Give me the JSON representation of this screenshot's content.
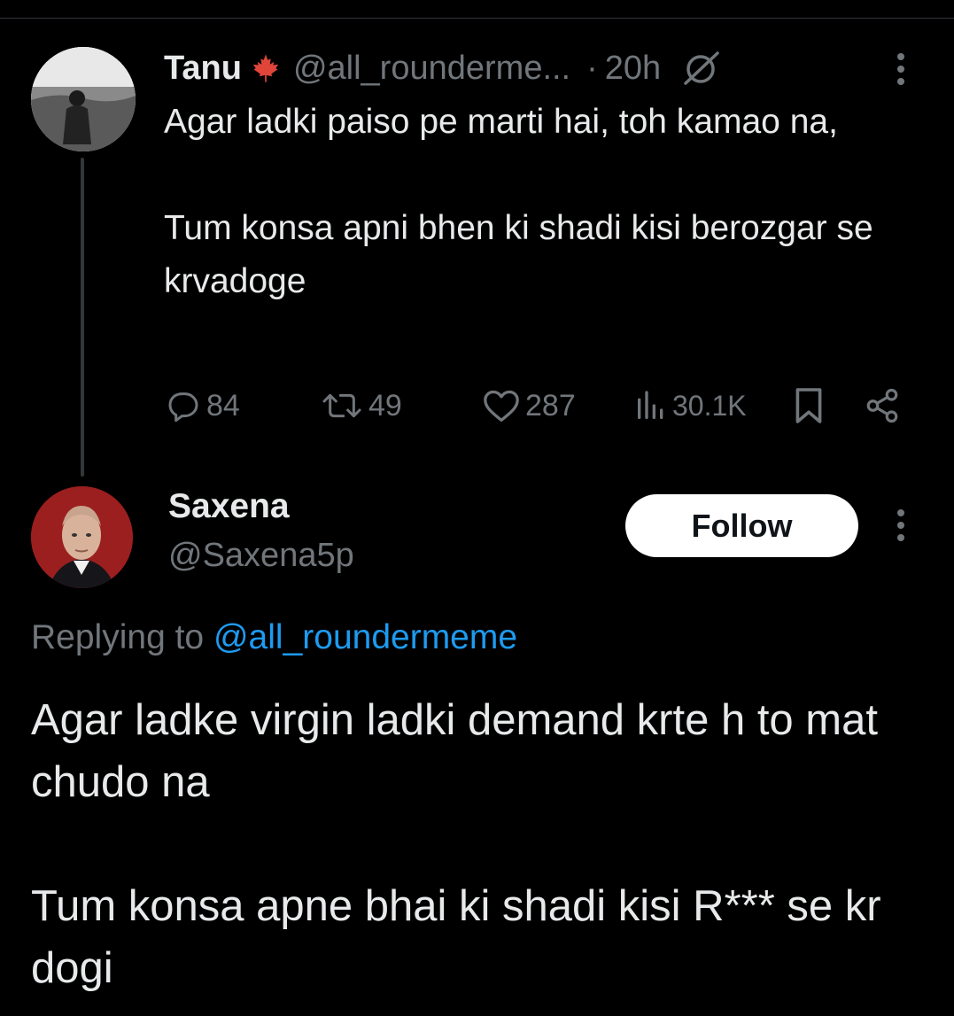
{
  "parent_tweet": {
    "author_name": "Tanu",
    "handle": "@all_rounderme...",
    "separator": "·",
    "time": "20h",
    "text_paragraph_1": "Agar ladki paiso pe marti hai, toh kamao na,",
    "text_paragraph_2": "Tum konsa apni bhen ki shadi kisi berozgar se krvadoge",
    "stats": {
      "replies": "84",
      "reposts": "49",
      "likes": "287",
      "views": "30.1K"
    },
    "icons": {
      "name_badge": "maple-leaf-icon",
      "time_badge": "muted-circle-icon",
      "menu": "more-vertical-icon",
      "reply": "reply-bubble-icon",
      "repost": "repost-icon",
      "like": "heart-icon",
      "views": "views-bars-icon",
      "bookmark": "bookmark-icon",
      "share": "share-icon"
    }
  },
  "reply_tweet": {
    "author_name": "Saxena",
    "handle": "@Saxena5p",
    "follow_label": "Follow",
    "replying_prefix": "Replying to",
    "replying_mention": "@all_roundermeme",
    "text_paragraph_1": "Agar ladke virgin ladki demand krte h to mat chudo na",
    "text_paragraph_2": "Tum konsa apne bhai ki shadi kisi R*** se kr dogi"
  },
  "colors": {
    "background": "#000000",
    "text_primary": "#e7e9ea",
    "text_secondary": "#71767b",
    "link": "#1d9bf0",
    "leaf": "#e0453a",
    "button_bg": "#ffffff"
  }
}
